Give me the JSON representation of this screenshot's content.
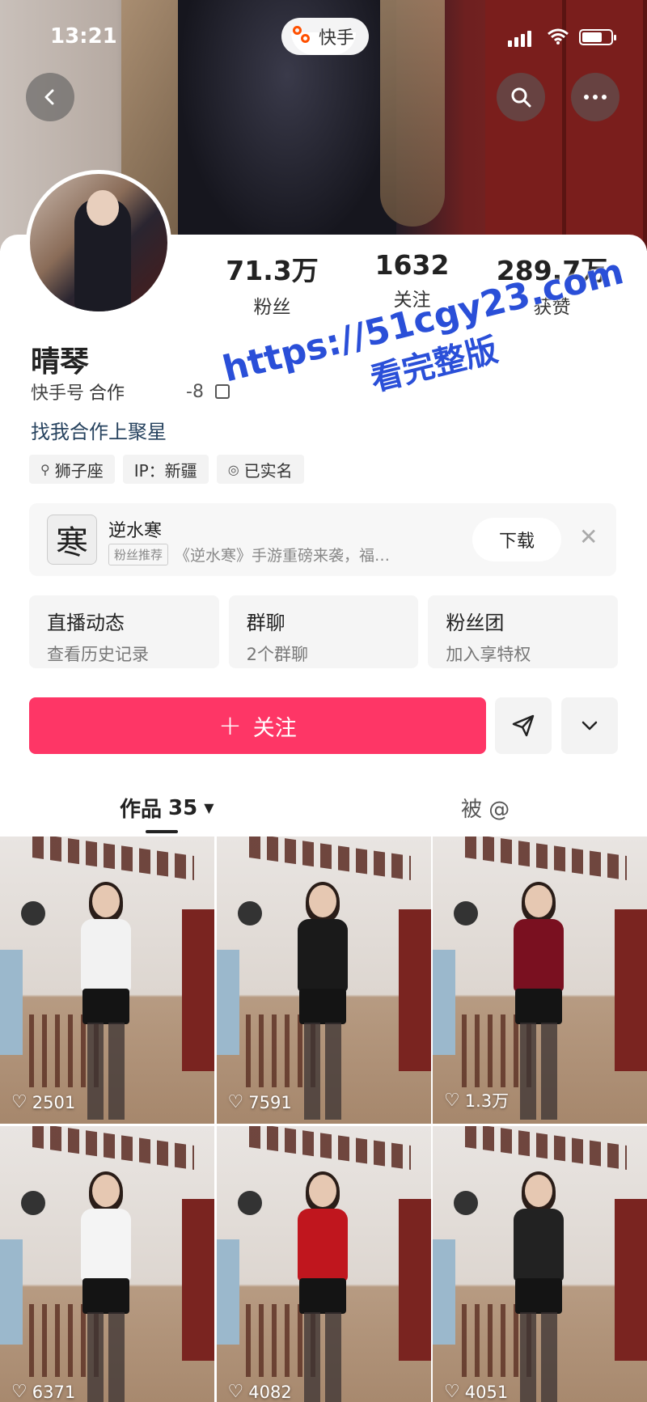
{
  "status": {
    "time": "13:21",
    "app_name": "快手"
  },
  "profile": {
    "followers": "71.3万",
    "followers_label": "粉丝",
    "following": "1632",
    "following_label": "关注",
    "likes": "289.7万",
    "likes_label": "获赞",
    "name": "晴琴",
    "id_label": "快手号",
    "id_value": "合作",
    "id_suffix": "-8",
    "bio": "找我合作上聚星",
    "tags": [
      {
        "icon": "zodiac-icon",
        "label": "狮子座"
      },
      {
        "icon": "",
        "label": "IP：新疆"
      },
      {
        "icon": "verified-icon",
        "label": "已实名"
      }
    ]
  },
  "watermark": {
    "line1": "https://51cgy23.com",
    "line2": "看完整版"
  },
  "ad": {
    "icon_glyph": "寒",
    "title": "逆水寒",
    "badge": "粉丝推荐",
    "description": "《逆水寒》手游重磅来袭，福…",
    "download_label": "下载"
  },
  "quick_cards": [
    {
      "title": "直播动态",
      "subtitle": "查看历史记录"
    },
    {
      "title": "群聊",
      "subtitle": "2个群聊"
    },
    {
      "title": "粉丝团",
      "subtitle": "加入享特权"
    }
  ],
  "actions": {
    "follow_label": "关注"
  },
  "tabs": {
    "works_label": "作品",
    "works_count": "35",
    "mentions_label": "被 @"
  },
  "videos": [
    {
      "likes": "2501",
      "top_color": "#f2f2f2"
    },
    {
      "likes": "7591",
      "top_color": "#1a1a1a"
    },
    {
      "likes": "1.3万",
      "top_color": "#7a1020"
    },
    {
      "likes": "6371",
      "top_color": "#f4f4f4"
    },
    {
      "likes": "4082",
      "top_color": "#c0161e"
    },
    {
      "likes": "4051",
      "top_color": "#222222"
    }
  ],
  "colors": {
    "follow_button": "#fe3666",
    "link": "#27435f",
    "watermark": "#2a4fd8"
  }
}
